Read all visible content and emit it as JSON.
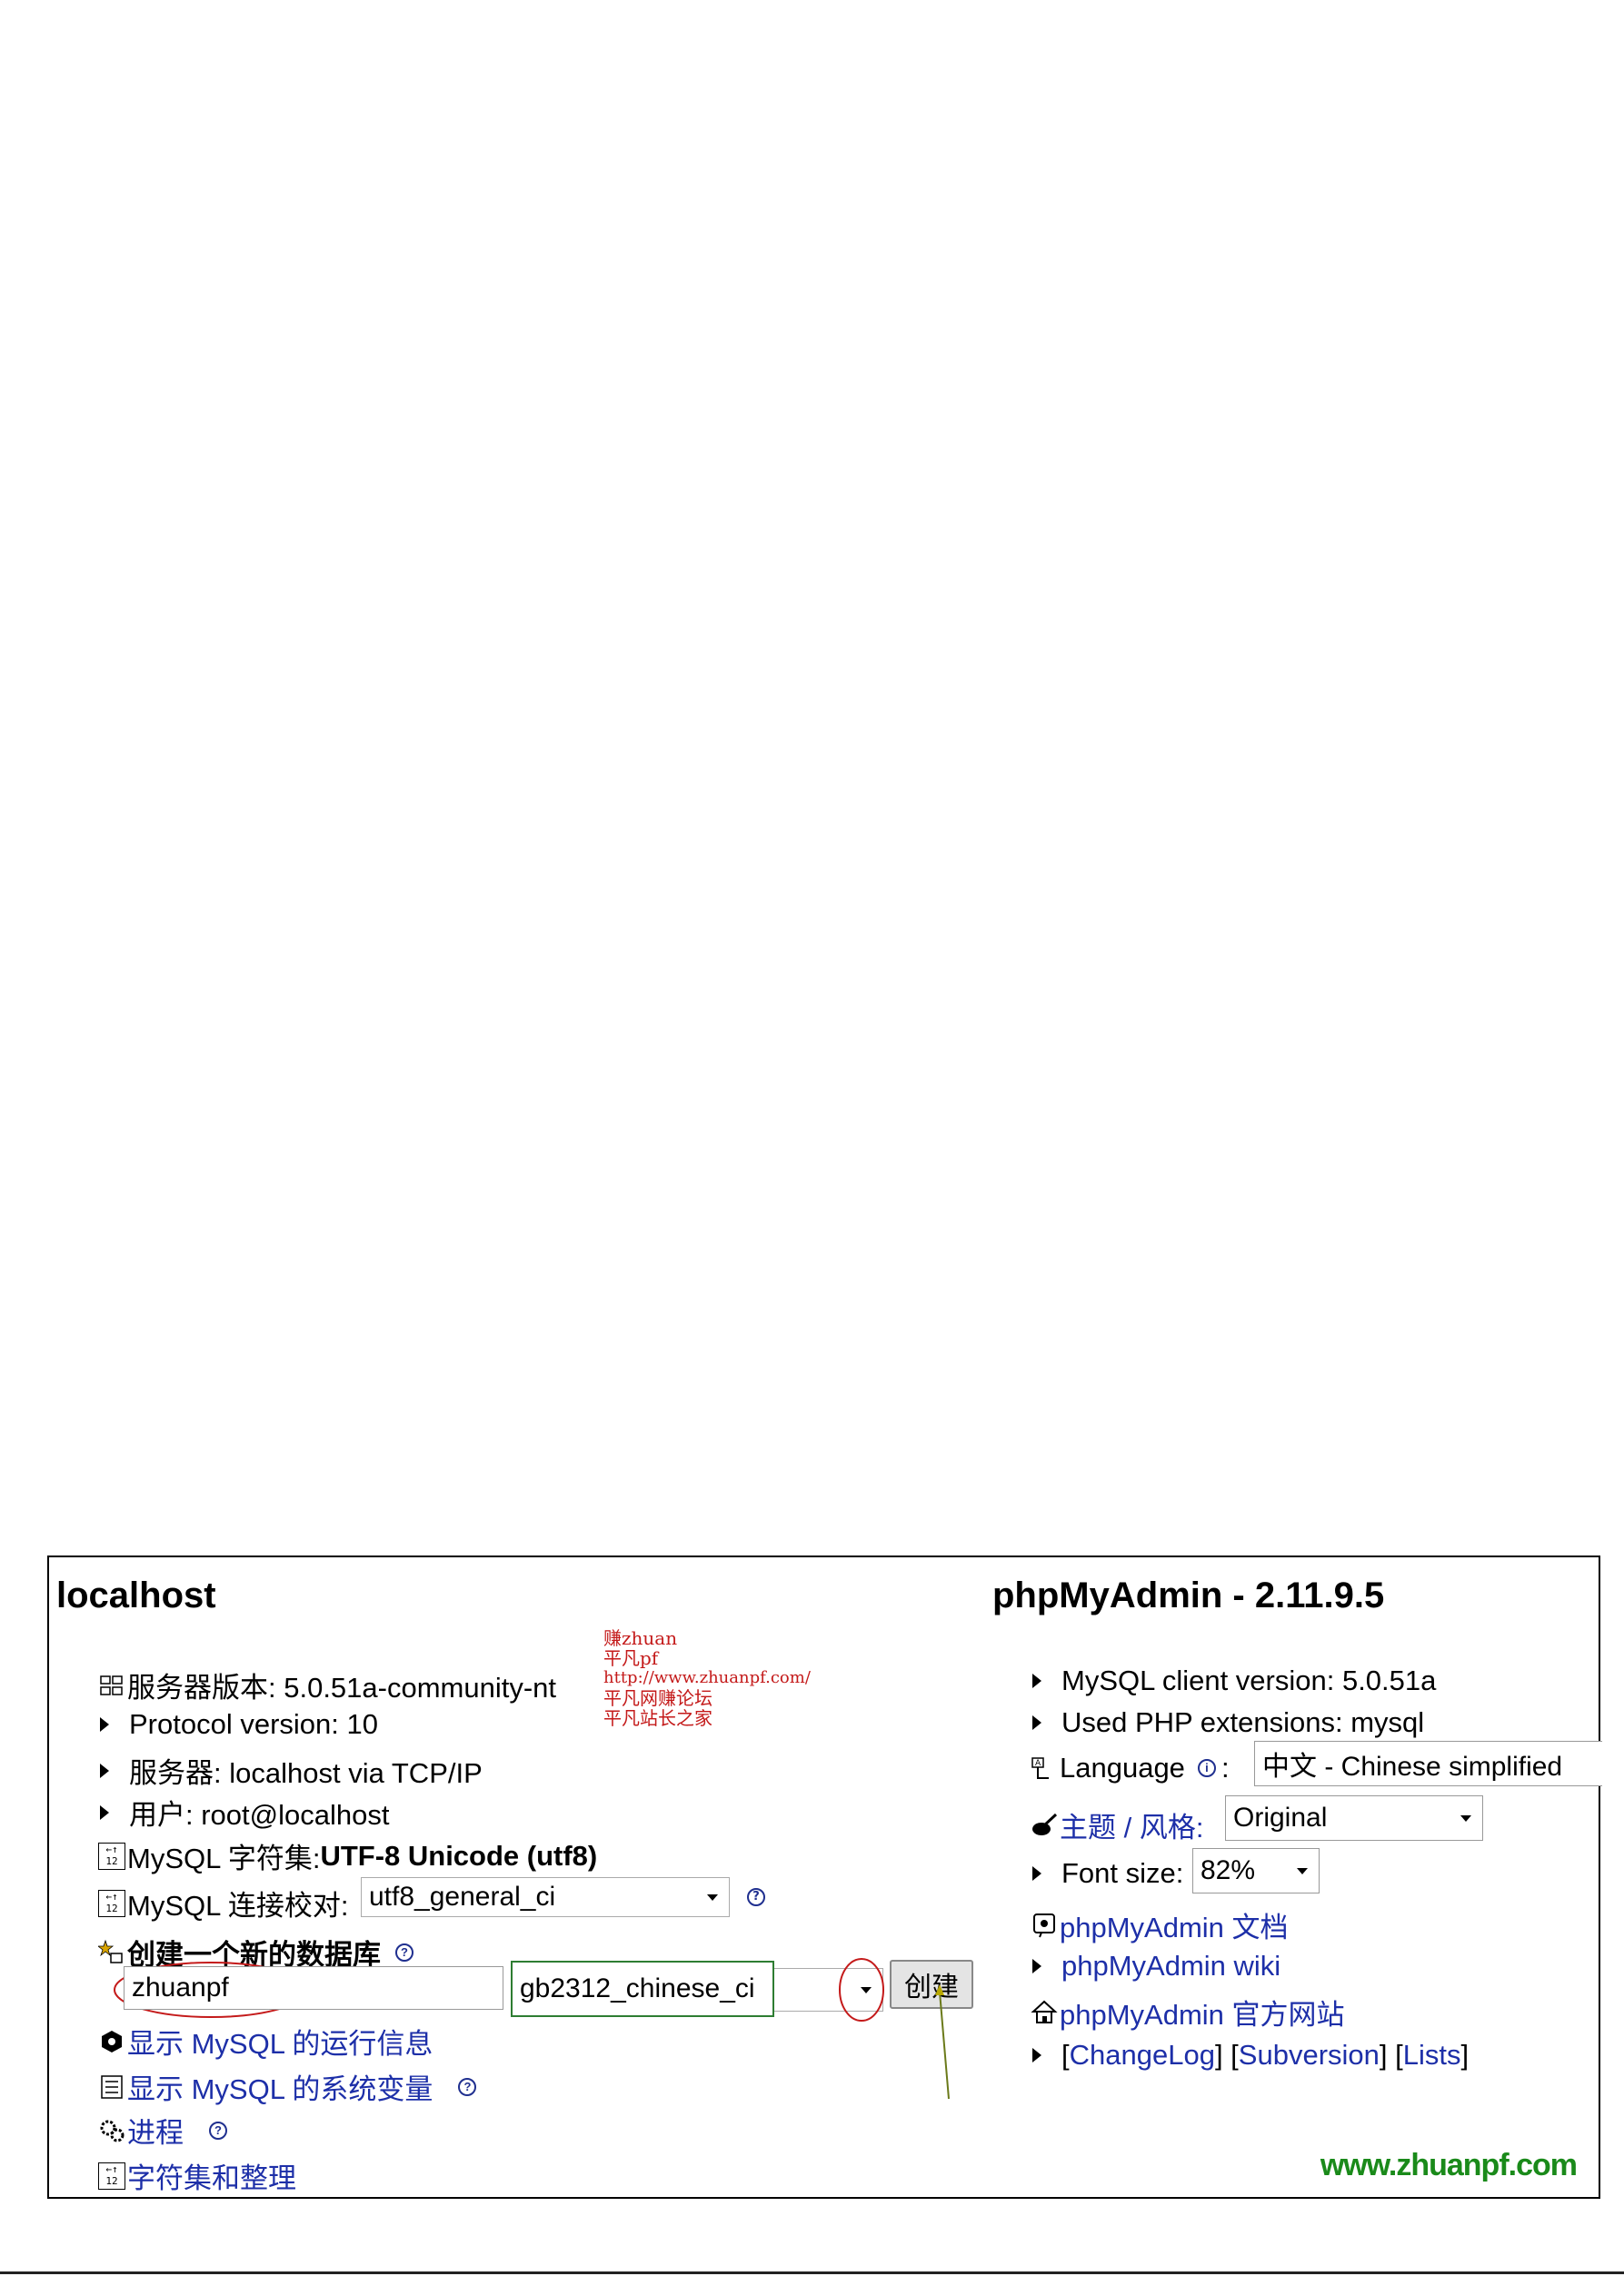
{
  "left": {
    "title": "localhost",
    "server_version": "服务器版本: 5.0.51a-community-nt",
    "protocol": "Protocol version: 10",
    "server": "服务器: localhost via TCP/IP",
    "user": "用户: root@localhost",
    "charset_label": "MySQL 字符集: ",
    "charset_value": "UTF-8 Unicode (utf8)",
    "collation_label": "MySQL 连接校对: ",
    "collation_value": "utf8_general_ci",
    "create_db_label": "创建一个新的数据库",
    "db_name_value": "zhuanpf",
    "db_collation_value": "gb2312_chinese_ci",
    "create_button": "创建",
    "links": {
      "show_status": "显示 MySQL 的运行信息",
      "show_variables": "显示 MySQL 的系统变量",
      "processes": "进程",
      "charsets": "字符集和整理"
    }
  },
  "right": {
    "title": "phpMyAdmin - 2.11.9.5",
    "client_version": "MySQL client version: 5.0.51a",
    "php_ext": "Used PHP extensions: mysql",
    "language_label": "Language",
    "language_value": "中文 - Chinese simplified",
    "theme_label": "主题 / 风格:",
    "theme_value": "Original",
    "font_size_label": "Font size:",
    "font_size_value": "82%",
    "docs": "phpMyAdmin 文档",
    "wiki": "phpMyAdmin wiki",
    "official": "phpMyAdmin 官方网站",
    "changelog": "ChangeLog",
    "subversion": "Subversion",
    "lists": "Lists"
  },
  "watermark": {
    "line1": "赚zhuan",
    "line2": "平凡pf",
    "line3": "http://www.zhuanpf.com/",
    "line4": "平凡网赚论坛",
    "line5": "平凡站长之家",
    "brand": "www.zhuanpf.com"
  },
  "colors": {
    "link": "#1d2fa8",
    "annotation_red": "#c41a1a",
    "annotation_green": "#2e7d32",
    "brand_green": "#1a8a1a"
  }
}
